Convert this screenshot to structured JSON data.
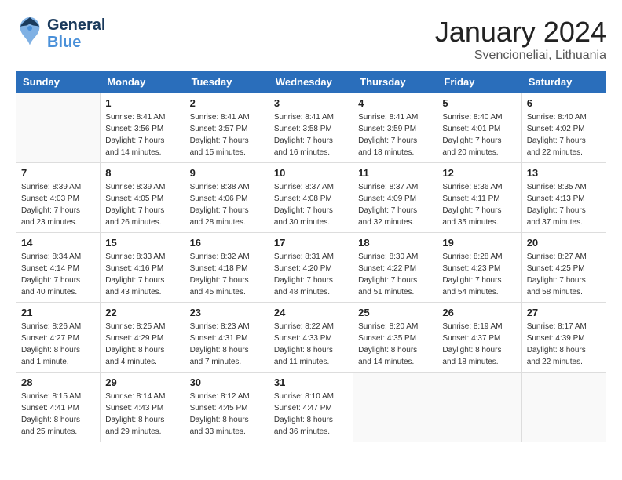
{
  "header": {
    "logo_general": "General",
    "logo_blue": "Blue",
    "month_title": "January 2024",
    "location": "Svencioneliai, Lithuania"
  },
  "calendar": {
    "days_of_week": [
      "Sunday",
      "Monday",
      "Tuesday",
      "Wednesday",
      "Thursday",
      "Friday",
      "Saturday"
    ],
    "weeks": [
      [
        {
          "day": "",
          "info": ""
        },
        {
          "day": "1",
          "info": "Sunrise: 8:41 AM\nSunset: 3:56 PM\nDaylight: 7 hours\nand 14 minutes."
        },
        {
          "day": "2",
          "info": "Sunrise: 8:41 AM\nSunset: 3:57 PM\nDaylight: 7 hours\nand 15 minutes."
        },
        {
          "day": "3",
          "info": "Sunrise: 8:41 AM\nSunset: 3:58 PM\nDaylight: 7 hours\nand 16 minutes."
        },
        {
          "day": "4",
          "info": "Sunrise: 8:41 AM\nSunset: 3:59 PM\nDaylight: 7 hours\nand 18 minutes."
        },
        {
          "day": "5",
          "info": "Sunrise: 8:40 AM\nSunset: 4:01 PM\nDaylight: 7 hours\nand 20 minutes."
        },
        {
          "day": "6",
          "info": "Sunrise: 8:40 AM\nSunset: 4:02 PM\nDaylight: 7 hours\nand 22 minutes."
        }
      ],
      [
        {
          "day": "7",
          "info": "Sunrise: 8:39 AM\nSunset: 4:03 PM\nDaylight: 7 hours\nand 23 minutes."
        },
        {
          "day": "8",
          "info": "Sunrise: 8:39 AM\nSunset: 4:05 PM\nDaylight: 7 hours\nand 26 minutes."
        },
        {
          "day": "9",
          "info": "Sunrise: 8:38 AM\nSunset: 4:06 PM\nDaylight: 7 hours\nand 28 minutes."
        },
        {
          "day": "10",
          "info": "Sunrise: 8:37 AM\nSunset: 4:08 PM\nDaylight: 7 hours\nand 30 minutes."
        },
        {
          "day": "11",
          "info": "Sunrise: 8:37 AM\nSunset: 4:09 PM\nDaylight: 7 hours\nand 32 minutes."
        },
        {
          "day": "12",
          "info": "Sunrise: 8:36 AM\nSunset: 4:11 PM\nDaylight: 7 hours\nand 35 minutes."
        },
        {
          "day": "13",
          "info": "Sunrise: 8:35 AM\nSunset: 4:13 PM\nDaylight: 7 hours\nand 37 minutes."
        }
      ],
      [
        {
          "day": "14",
          "info": "Sunrise: 8:34 AM\nSunset: 4:14 PM\nDaylight: 7 hours\nand 40 minutes."
        },
        {
          "day": "15",
          "info": "Sunrise: 8:33 AM\nSunset: 4:16 PM\nDaylight: 7 hours\nand 43 minutes."
        },
        {
          "day": "16",
          "info": "Sunrise: 8:32 AM\nSunset: 4:18 PM\nDaylight: 7 hours\nand 45 minutes."
        },
        {
          "day": "17",
          "info": "Sunrise: 8:31 AM\nSunset: 4:20 PM\nDaylight: 7 hours\nand 48 minutes."
        },
        {
          "day": "18",
          "info": "Sunrise: 8:30 AM\nSunset: 4:22 PM\nDaylight: 7 hours\nand 51 minutes."
        },
        {
          "day": "19",
          "info": "Sunrise: 8:28 AM\nSunset: 4:23 PM\nDaylight: 7 hours\nand 54 minutes."
        },
        {
          "day": "20",
          "info": "Sunrise: 8:27 AM\nSunset: 4:25 PM\nDaylight: 7 hours\nand 58 minutes."
        }
      ],
      [
        {
          "day": "21",
          "info": "Sunrise: 8:26 AM\nSunset: 4:27 PM\nDaylight: 8 hours\nand 1 minute."
        },
        {
          "day": "22",
          "info": "Sunrise: 8:25 AM\nSunset: 4:29 PM\nDaylight: 8 hours\nand 4 minutes."
        },
        {
          "day": "23",
          "info": "Sunrise: 8:23 AM\nSunset: 4:31 PM\nDaylight: 8 hours\nand 7 minutes."
        },
        {
          "day": "24",
          "info": "Sunrise: 8:22 AM\nSunset: 4:33 PM\nDaylight: 8 hours\nand 11 minutes."
        },
        {
          "day": "25",
          "info": "Sunrise: 8:20 AM\nSunset: 4:35 PM\nDaylight: 8 hours\nand 14 minutes."
        },
        {
          "day": "26",
          "info": "Sunrise: 8:19 AM\nSunset: 4:37 PM\nDaylight: 8 hours\nand 18 minutes."
        },
        {
          "day": "27",
          "info": "Sunrise: 8:17 AM\nSunset: 4:39 PM\nDaylight: 8 hours\nand 22 minutes."
        }
      ],
      [
        {
          "day": "28",
          "info": "Sunrise: 8:15 AM\nSunset: 4:41 PM\nDaylight: 8 hours\nand 25 minutes."
        },
        {
          "day": "29",
          "info": "Sunrise: 8:14 AM\nSunset: 4:43 PM\nDaylight: 8 hours\nand 29 minutes."
        },
        {
          "day": "30",
          "info": "Sunrise: 8:12 AM\nSunset: 4:45 PM\nDaylight: 8 hours\nand 33 minutes."
        },
        {
          "day": "31",
          "info": "Sunrise: 8:10 AM\nSunset: 4:47 PM\nDaylight: 8 hours\nand 36 minutes."
        },
        {
          "day": "",
          "info": ""
        },
        {
          "day": "",
          "info": ""
        },
        {
          "day": "",
          "info": ""
        }
      ]
    ]
  }
}
